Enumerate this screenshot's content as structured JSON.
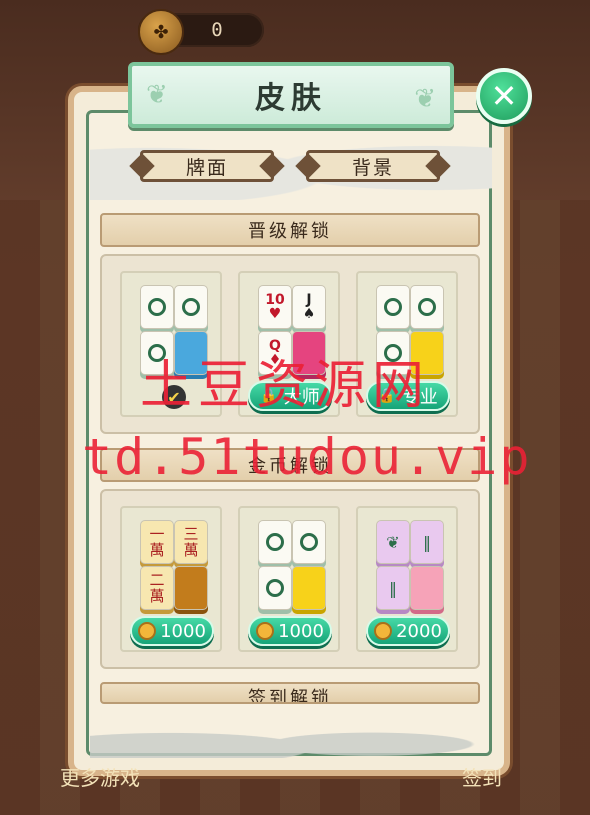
{
  "currency": {
    "icon": "clover-coin-icon",
    "value": "0"
  },
  "title": "皮肤",
  "tabs": [
    {
      "label": "牌面"
    },
    {
      "label": "背景"
    }
  ],
  "sections": {
    "upgrade": {
      "title": "晋级解锁",
      "cards": [
        {
          "name": "classic-green-skin",
          "status": "equipped",
          "button_label": ""
        },
        {
          "name": "poker-skin",
          "button_label": "大师",
          "locked": true
        },
        {
          "name": "yellow-skin",
          "button_label": "专业",
          "locked": true
        }
      ]
    },
    "coin": {
      "title": "金币解锁",
      "cards": [
        {
          "name": "wan-skin",
          "price": "1000"
        },
        {
          "name": "circle-yellow-skin",
          "price": "1000"
        },
        {
          "name": "bamboo-pink-skin",
          "price": "2000"
        }
      ]
    },
    "series_title": "签到解锁"
  },
  "footer": {
    "left": "更多游戏",
    "right": "签到"
  },
  "watermark": {
    "line1": "土豆资源网",
    "line2": "td.51tudou.vip"
  },
  "colors": {
    "accent_green": "#16a478",
    "panel_bg": "#f4ecd9",
    "watermark": "#ea2135"
  }
}
